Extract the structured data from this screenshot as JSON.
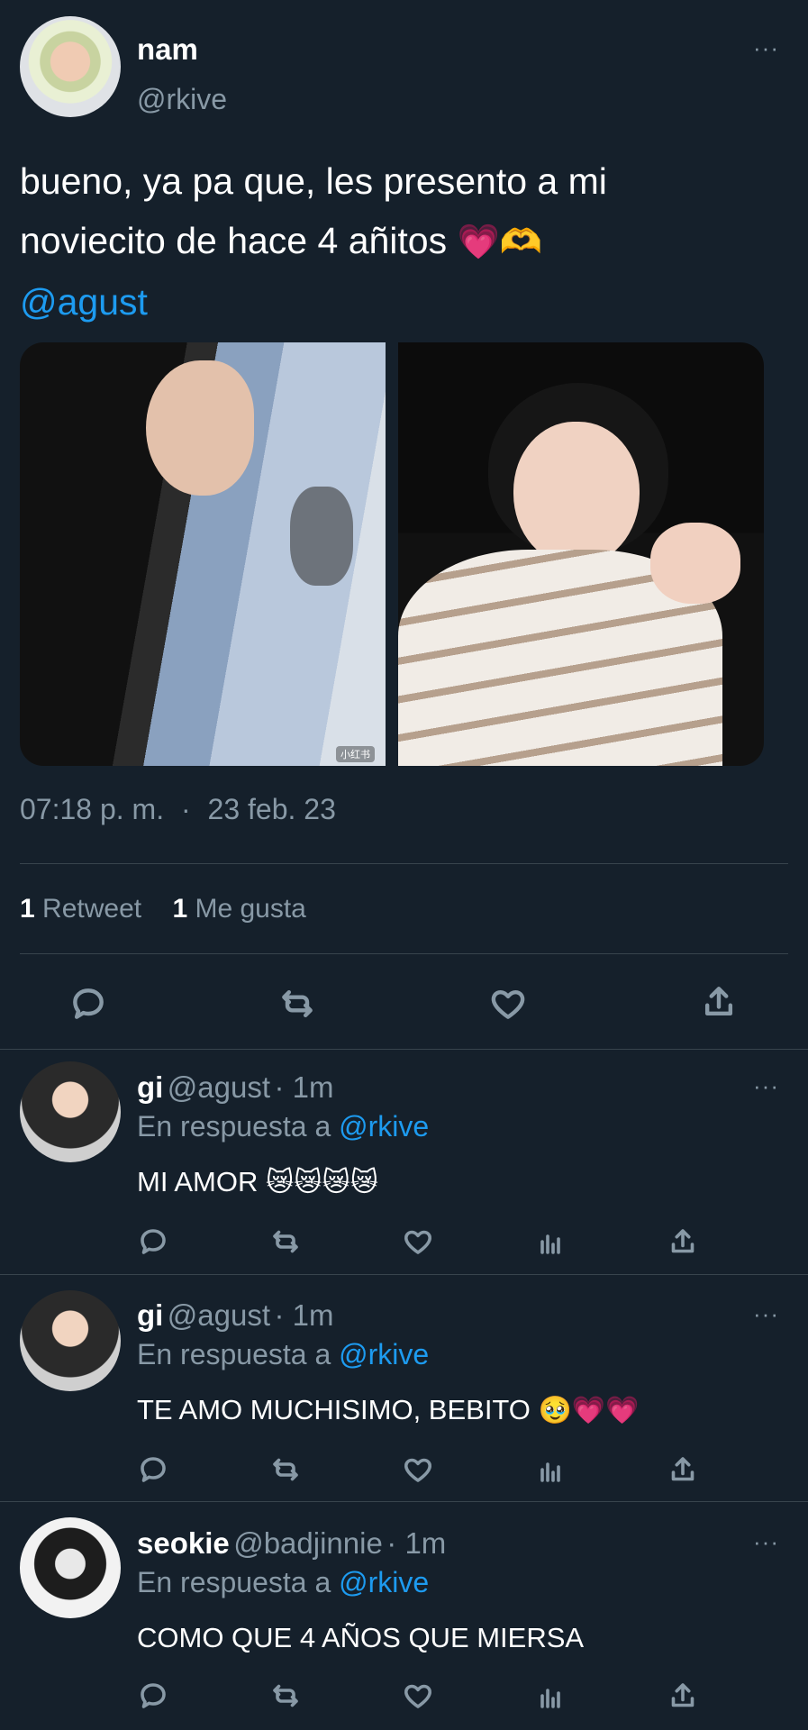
{
  "tweet": {
    "display_name": "nam",
    "handle": "@rkive",
    "text_line1": "bueno, ya pa que, les presento a mi",
    "text_line2": "noviecito de hace 4 añitos",
    "emoji_line2": "💗🫶",
    "mention": "@agust",
    "time": "07:18 p. m.",
    "separator": "·",
    "date": "23 feb. 23",
    "retweet_count": "1",
    "retweet_label": "Retweet",
    "like_count": "1",
    "like_label": "Me gusta",
    "photo_watermark": "小红书",
    "more": "···"
  },
  "replies": [
    {
      "name": "gi",
      "handle": "@agust",
      "meta": "· 1m",
      "reply_prefix": "En respuesta a",
      "reply_to": "@rkive",
      "text": "MI AMOR",
      "emoji": "😿😿😿😿",
      "more": "···"
    },
    {
      "name": "gi",
      "handle": "@agust",
      "meta": "· 1m",
      "reply_prefix": "En respuesta a",
      "reply_to": "@rkive",
      "text": "TE AMO MUCHISIMO, BEBITO",
      "emoji": "🥹💗💗",
      "more": "···"
    },
    {
      "name": "seokie",
      "handle": "@badjinnie",
      "meta": "· 1m",
      "reply_prefix": "En respuesta a",
      "reply_to": "@rkive",
      "text": "COMO QUE 4 AÑOS QUE MIERSA",
      "emoji": "",
      "more": "···"
    }
  ]
}
